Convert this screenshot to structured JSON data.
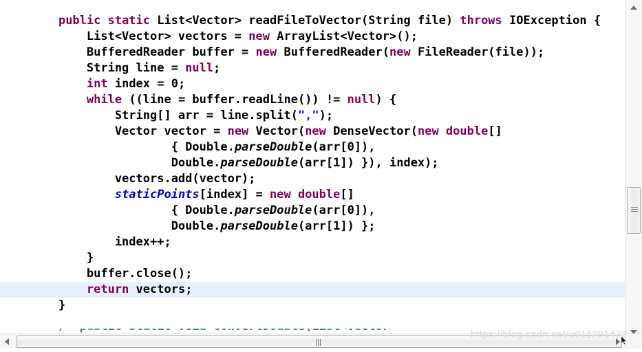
{
  "editor": {
    "language": "Java",
    "theme": "eclipse-light",
    "colors": {
      "background": "#ffffff",
      "foreground": "#000000",
      "keyword": "#7f0055",
      "string": "#2a00ff",
      "comment": "#3f7f5f",
      "static_field": "#0000c0",
      "current_line_highlight": "#e8f0fb",
      "scrollbar_track": "#f6f6f6",
      "scrollbar_thumb_border": "#a8a8a8"
    },
    "lines": [
      {
        "id": 1,
        "highlighted": false,
        "tokens": [
          {
            "t": "    ",
            "c": "pl"
          },
          {
            "t": "public static ",
            "c": "kw"
          },
          {
            "t": "List<Vector> readFileToVector(String file) ",
            "c": "pl"
          },
          {
            "t": "throws ",
            "c": "kw"
          },
          {
            "t": "IOException {",
            "c": "pl"
          }
        ]
      },
      {
        "id": 2,
        "highlighted": false,
        "tokens": [
          {
            "t": "        List<Vector> vectors = ",
            "c": "pl"
          },
          {
            "t": "new ",
            "c": "kw"
          },
          {
            "t": "ArrayList<Vector>();",
            "c": "pl"
          }
        ]
      },
      {
        "id": 3,
        "highlighted": false,
        "tokens": [
          {
            "t": "        BufferedReader buffer = ",
            "c": "pl"
          },
          {
            "t": "new ",
            "c": "kw"
          },
          {
            "t": "BufferedReader(",
            "c": "pl"
          },
          {
            "t": "new ",
            "c": "kw"
          },
          {
            "t": "FileReader(file));",
            "c": "pl"
          }
        ]
      },
      {
        "id": 4,
        "highlighted": false,
        "tokens": [
          {
            "t": "        String line = ",
            "c": "pl"
          },
          {
            "t": "null",
            "c": "kw"
          },
          {
            "t": ";",
            "c": "pl"
          }
        ]
      },
      {
        "id": 5,
        "highlighted": false,
        "tokens": [
          {
            "t": "        ",
            "c": "pl"
          },
          {
            "t": "int ",
            "c": "kw"
          },
          {
            "t": "index = 0;",
            "c": "pl"
          }
        ]
      },
      {
        "id": 6,
        "highlighted": false,
        "tokens": [
          {
            "t": "        ",
            "c": "pl"
          },
          {
            "t": "while ",
            "c": "kw"
          },
          {
            "t": "((line = buffer.readLine()) != ",
            "c": "pl"
          },
          {
            "t": "null",
            "c": "kw"
          },
          {
            "t": ") {",
            "c": "pl"
          }
        ]
      },
      {
        "id": 7,
        "highlighted": false,
        "tokens": [
          {
            "t": "            String[] arr = line.split(",
            "c": "pl"
          },
          {
            "t": "\",\"",
            "c": "str"
          },
          {
            "t": ");",
            "c": "pl"
          }
        ]
      },
      {
        "id": 8,
        "highlighted": false,
        "tokens": [
          {
            "t": "            Vector vector = ",
            "c": "pl"
          },
          {
            "t": "new ",
            "c": "kw"
          },
          {
            "t": "Vector(",
            "c": "pl"
          },
          {
            "t": "new ",
            "c": "kw"
          },
          {
            "t": "DenseVector(",
            "c": "pl"
          },
          {
            "t": "new double",
            "c": "kw"
          },
          {
            "t": "[]",
            "c": "pl"
          }
        ]
      },
      {
        "id": 9,
        "highlighted": false,
        "tokens": [
          {
            "t": "                    { Double.",
            "c": "pl"
          },
          {
            "t": "parseDouble",
            "c": "smth"
          },
          {
            "t": "(arr[0]),",
            "c": "pl"
          }
        ]
      },
      {
        "id": 10,
        "highlighted": false,
        "tokens": [
          {
            "t": "                    Double.",
            "c": "pl"
          },
          {
            "t": "parseDouble",
            "c": "smth"
          },
          {
            "t": "(arr[1]) }), index);",
            "c": "pl"
          }
        ]
      },
      {
        "id": 11,
        "highlighted": false,
        "tokens": [
          {
            "t": "            vectors.add(vector);",
            "c": "pl"
          }
        ]
      },
      {
        "id": 12,
        "highlighted": false,
        "tokens": [
          {
            "t": "            ",
            "c": "pl"
          },
          {
            "t": "staticPoints",
            "c": "sfld"
          },
          {
            "t": "[index] = ",
            "c": "pl"
          },
          {
            "t": "new double",
            "c": "kw"
          },
          {
            "t": "[]",
            "c": "pl"
          }
        ]
      },
      {
        "id": 13,
        "highlighted": false,
        "tokens": [
          {
            "t": "                    { Double.",
            "c": "pl"
          },
          {
            "t": "parseDouble",
            "c": "smth"
          },
          {
            "t": "(arr[0]),",
            "c": "pl"
          }
        ]
      },
      {
        "id": 14,
        "highlighted": false,
        "tokens": [
          {
            "t": "                    Double.",
            "c": "pl"
          },
          {
            "t": "parseDouble",
            "c": "smth"
          },
          {
            "t": "(arr[1]) };",
            "c": "pl"
          }
        ]
      },
      {
        "id": 15,
        "highlighted": false,
        "tokens": [
          {
            "t": "            index++;",
            "c": "pl"
          }
        ]
      },
      {
        "id": 16,
        "highlighted": false,
        "tokens": [
          {
            "t": "        }",
            "c": "pl"
          }
        ]
      },
      {
        "id": 17,
        "highlighted": false,
        "tokens": [
          {
            "t": "        buffer.close();",
            "c": "pl"
          }
        ]
      },
      {
        "id": 18,
        "highlighted": true,
        "tokens": [
          {
            "t": "        ",
            "c": "pl"
          },
          {
            "t": "return ",
            "c": "kw"
          },
          {
            "t": "vectors;",
            "c": "pl"
          }
        ]
      },
      {
        "id": 19,
        "highlighted": false,
        "tokens": [
          {
            "t": "    }",
            "c": "pl"
          }
        ]
      },
      {
        "id": 20,
        "highlighted": false,
        "tokens": [
          {
            "t": "",
            "c": "pl"
          }
        ]
      }
    ],
    "clipped_comment_line": {
      "tokens": [
        {
          "t": "    /* public static void convertDouble(List<Vector> ",
          "c": "cmt"
        }
      ]
    }
  },
  "watermark": {
    "text": "https://blog.csdn.net/u011291472"
  },
  "scrollbars": {
    "vertical": {
      "up_arrow": "scroll-up",
      "down_arrow": "scroll-down",
      "thumb": "vertical-thumb"
    },
    "horizontal": {
      "left_arrow": "scroll-left",
      "right_arrow": "scroll-right",
      "thumb": "horizontal-thumb"
    }
  }
}
